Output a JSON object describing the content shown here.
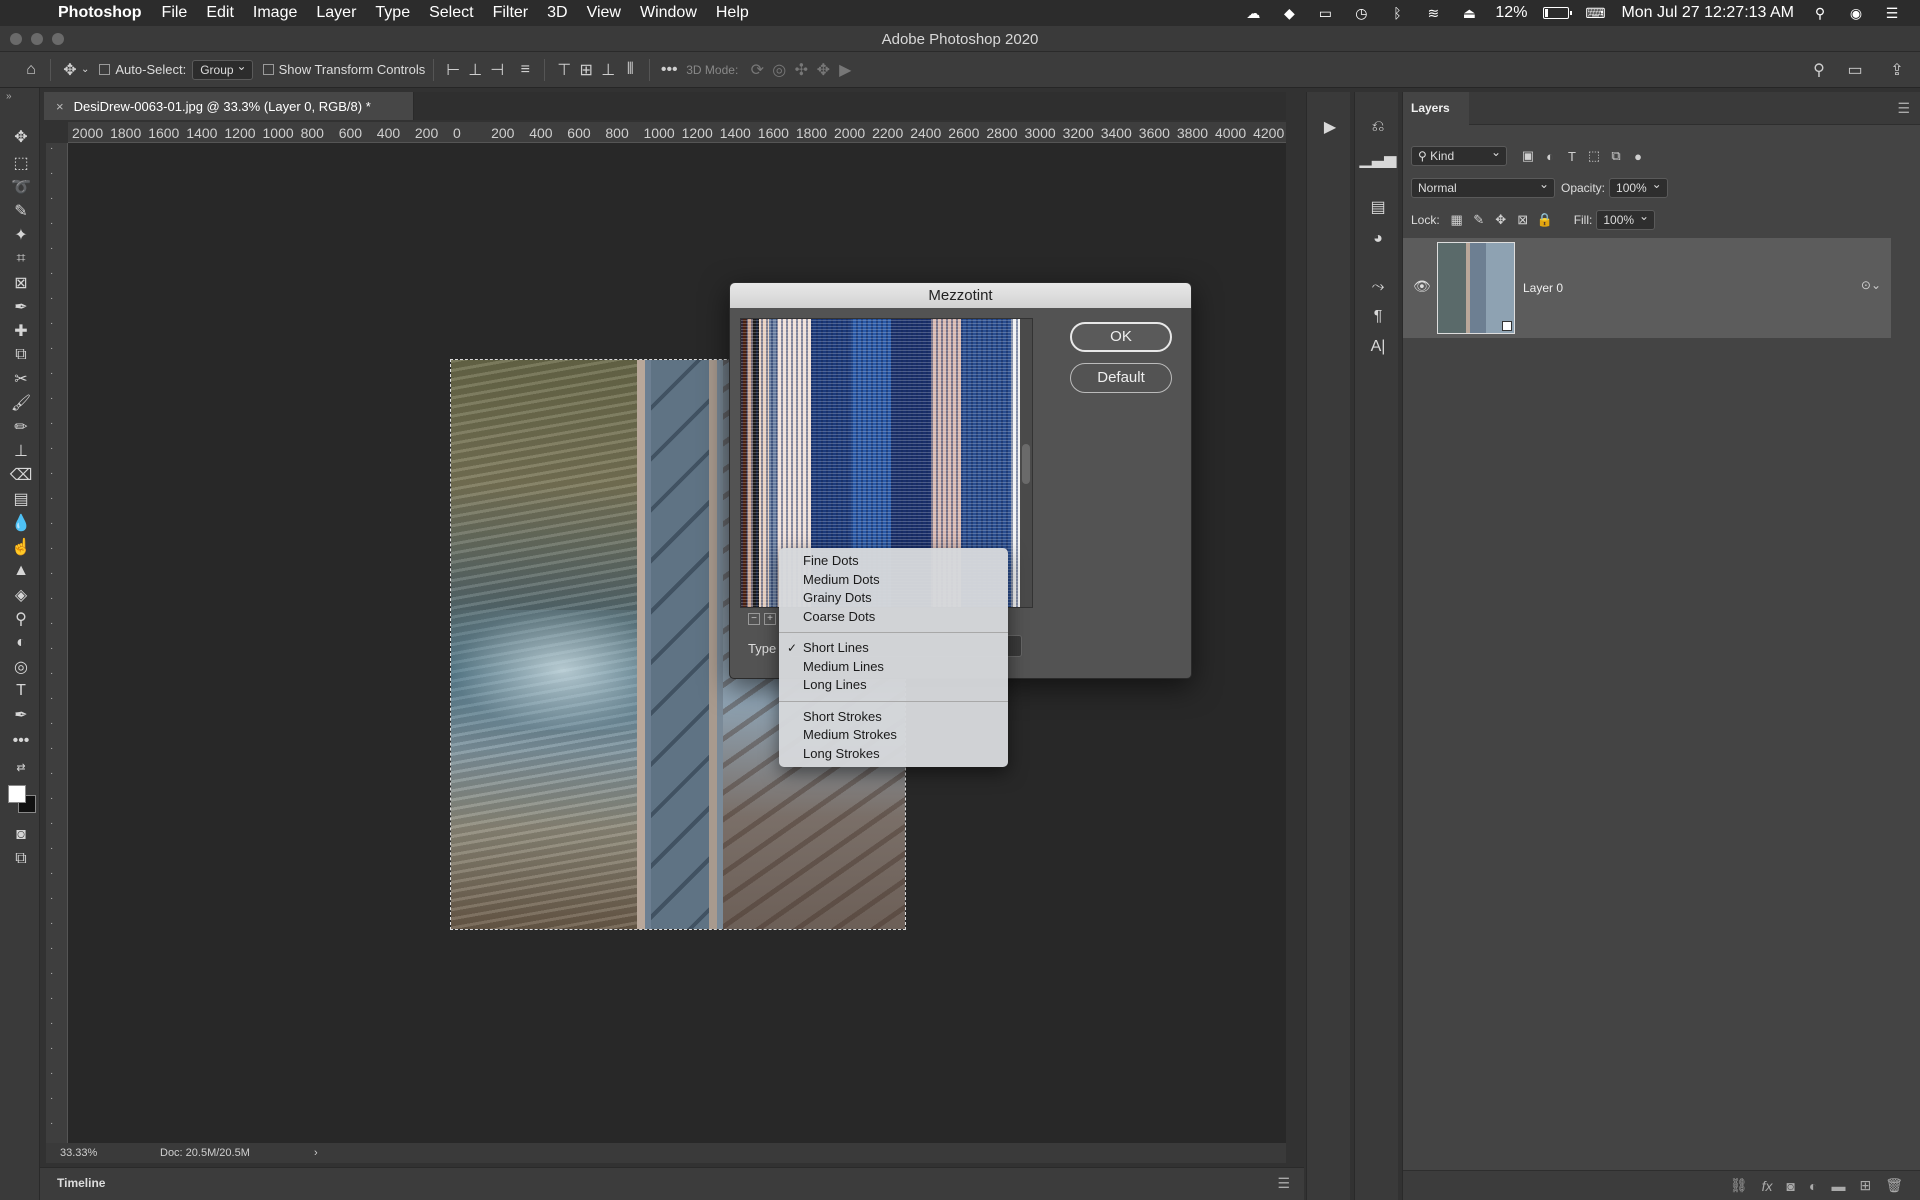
{
  "menubar": {
    "app_name": "Photoshop",
    "items": [
      "File",
      "Edit",
      "Image",
      "Layer",
      "Type",
      "Select",
      "Filter",
      "3D",
      "View",
      "Window",
      "Help"
    ],
    "battery": "12%",
    "battery_level": 0.12,
    "datetime": "Mon Jul 27  12:27:13 AM"
  },
  "window": {
    "title": "Adobe Photoshop 2020"
  },
  "options": {
    "auto_select_label": "Auto-Select:",
    "auto_select_value": "Group",
    "transform_label": "Show Transform Controls",
    "mode3d_label": "3D Mode:"
  },
  "document": {
    "tab_label": "DesiDrew-0063-01.jpg @ 33.3% (Layer 0, RGB/8) *",
    "zoom": "33.33%",
    "doc_size": "Doc: 20.5M/20.5M"
  },
  "ruler": {
    "h_labels": [
      "2000",
      "1800",
      "1600",
      "1400",
      "1200",
      "1000",
      "800",
      "600",
      "400",
      "200",
      "0",
      "200",
      "400",
      "600",
      "800",
      "1000",
      "1200",
      "1400",
      "1600",
      "1800",
      "2000",
      "2200",
      "2400",
      "2600",
      "2800",
      "3000",
      "3200",
      "3400",
      "3600",
      "3800",
      "4000",
      "4200"
    ]
  },
  "dialog": {
    "title": "Mezzotint",
    "ok_label": "OK",
    "default_label": "Default",
    "type_label": "Type",
    "zoom_out": "−",
    "zoom_in": "+"
  },
  "dropdown": {
    "group1": [
      "Fine Dots",
      "Medium Dots",
      "Grainy Dots",
      "Coarse Dots"
    ],
    "group2": [
      "Short Lines",
      "Medium Lines",
      "Long Lines"
    ],
    "group3": [
      "Short Strokes",
      "Medium Strokes",
      "Long Strokes"
    ],
    "selected": "Short Lines",
    "check": "✓"
  },
  "timeline": {
    "label": "Timeline"
  },
  "layers": {
    "tab_label": "Layers",
    "filter_value": "Kind",
    "blend_mode": "Normal",
    "opacity_label": "Opacity:",
    "opacity_value": "100%",
    "lock_label": "Lock:",
    "fill_label": "Fill:",
    "fill_value": "100%",
    "layer_name": "Layer 0"
  }
}
